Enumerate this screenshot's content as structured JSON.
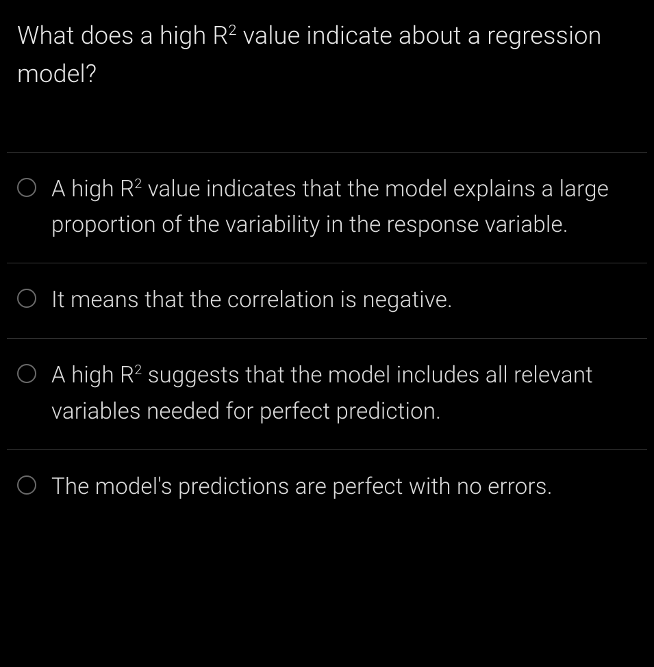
{
  "question": {
    "text_html": "What does a high R<sup>2</sup> value indicate about a regression model?"
  },
  "options": [
    {
      "text_html": "A high R<sup>2</sup> value indicates that the model explains a large proportion of the variability in the response variable."
    },
    {
      "text_html": "It means that the correlation is negative."
    },
    {
      "text_html": "A high R<sup>2</sup> suggests that the model includes all relevant variables needed for perfect prediction."
    },
    {
      "text_html": "The model's predictions are perfect with no errors."
    }
  ]
}
